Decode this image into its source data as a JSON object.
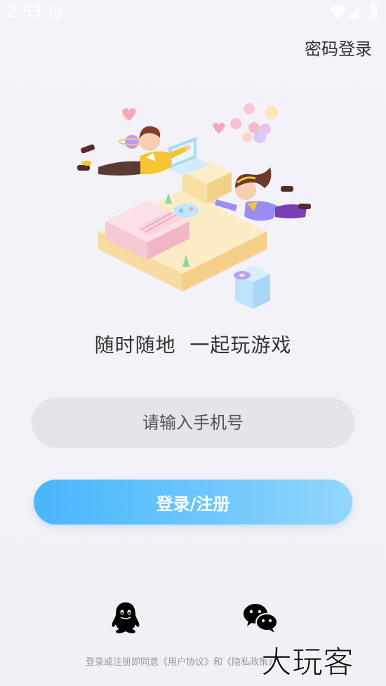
{
  "status_bar": {
    "time": "2:53",
    "icons": [
      "a-notification-icon",
      "wifi-icon",
      "signal-icon",
      "battery-icon"
    ]
  },
  "header": {
    "password_login": "密码登录"
  },
  "main": {
    "tagline": "随时随地  一起玩游戏",
    "phone_placeholder": "请输入手机号",
    "login_button": "登录/注册"
  },
  "social": {
    "icons": [
      "qq-icon",
      "wechat-icon"
    ]
  },
  "agreement": {
    "prefix": "登录或注册即同意",
    "user_agreement": "《用户协议》",
    "and": "和",
    "privacy_policy": "《隐私政策》"
  },
  "watermark": {
    "text": "大玩客"
  },
  "colors": {
    "background": "#f2f1f7",
    "accent": "#49b6fb",
    "input_bg": "#e5e4ea",
    "text_dark": "#333333"
  }
}
